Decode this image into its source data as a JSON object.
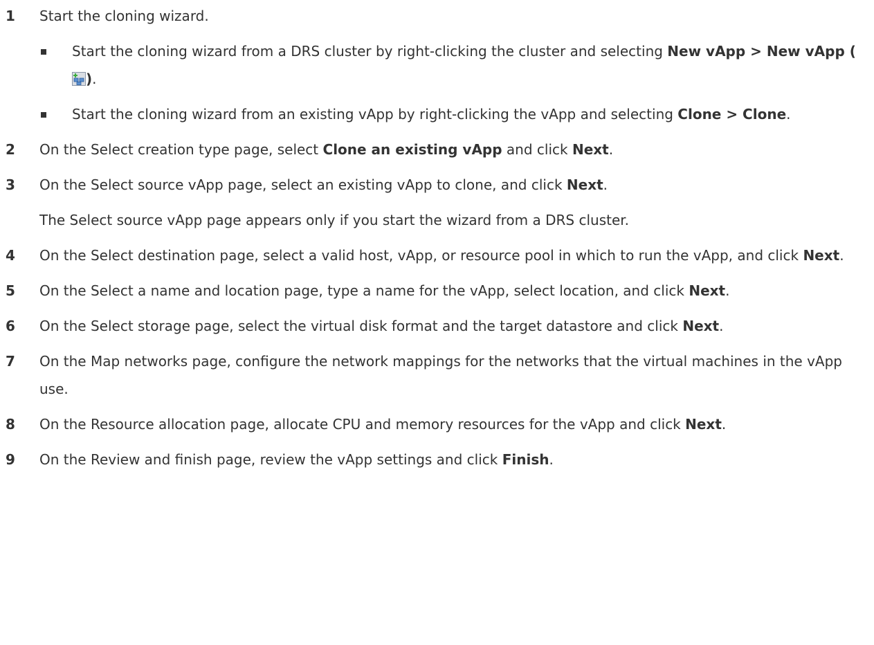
{
  "steps": [
    {
      "num": "1",
      "text": "Start the cloning wizard.",
      "bullets": [
        {
          "pre": "Start the cloning wizard from a DRS cluster by right-clicking the cluster and selecting ",
          "bold": "New vApp > New vApp (",
          "bold_end": ")",
          "post": "."
        },
        {
          "pre": "Start the cloning wizard from an existing vApp by right-clicking the vApp and selecting ",
          "bold": "Clone > Clone",
          "post": "."
        }
      ]
    },
    {
      "num": "2",
      "pre": "On the Select creation type page, select ",
      "bold1": "Clone an existing vApp",
      "mid": " and click ",
      "bold2": "Next",
      "post": "."
    },
    {
      "num": "3",
      "pre": "On the Select source vApp page, select an existing vApp to clone, and click ",
      "bold1": "Next",
      "post": ".",
      "note": "The Select source vApp page appears only if you start the wizard from a DRS cluster."
    },
    {
      "num": "4",
      "pre": "On the Select destination page, select a valid host, vApp, or resource pool in which to run the vApp, and click ",
      "bold1": "Next",
      "post": "."
    },
    {
      "num": "5",
      "pre": "On the Select a name and location page, type a name for the vApp, select location, and click ",
      "bold1": "Next",
      "post": "."
    },
    {
      "num": "6",
      "pre": "On the Select storage page, select the virtual disk format and the target datastore and click ",
      "bold1": "Next",
      "post": "."
    },
    {
      "num": "7",
      "pre": "On the Map networks page, configure the network mappings for the networks that the virtual machines in the vApp use."
    },
    {
      "num": "8",
      "pre": "On the Resource allocation page, allocate CPU and memory resources for the vApp and click ",
      "bold1": "Next",
      "post": "."
    },
    {
      "num": "9",
      "pre": "On the Review and finish page, review the vApp settings and click ",
      "bold1": "Finish",
      "post": "."
    }
  ],
  "icon": "new-vapp-icon"
}
